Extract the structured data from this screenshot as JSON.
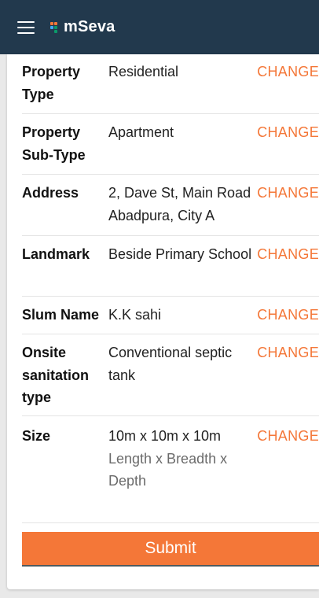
{
  "header": {
    "menu_icon": "hamburger-menu-icon",
    "logo_text": "mSeva"
  },
  "details": [
    {
      "label": "Property Type",
      "value": "Residential",
      "sub": "",
      "action": "CHANGE"
    },
    {
      "label": "Property Sub-Type",
      "value": "Apartment",
      "sub": "",
      "action": "CHANGE"
    },
    {
      "label": "Address",
      "value": "2, Dave St, Main Road Abadpura, City A",
      "sub": "",
      "action": "CHANGE"
    },
    {
      "label": "Landmark",
      "value": "Beside Primary School",
      "sub": "",
      "action": "CHANGE"
    },
    {
      "label": "Slum Name",
      "value": "K.K sahi",
      "sub": "",
      "action": "CHANGE"
    },
    {
      "label": "Onsite sanitation type",
      "value": "Conventional septic tank",
      "sub": "",
      "action": "CHANGE"
    },
    {
      "label": "Size",
      "value": "10m x 10m x 10m",
      "sub": "Length x Breadth x Depth",
      "action": "CHANGE"
    }
  ],
  "submit_label": "Submit",
  "colors": {
    "header_bg": "#22394d",
    "accent": "#f47738"
  }
}
